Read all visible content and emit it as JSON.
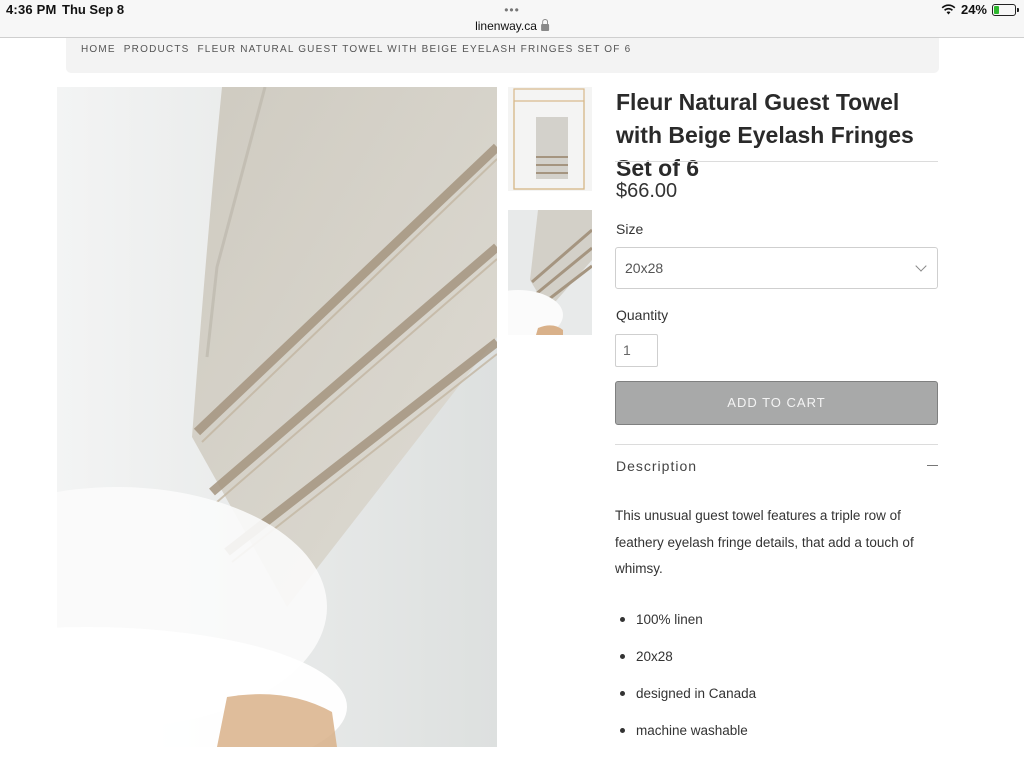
{
  "status_bar": {
    "time": "4:36 PM",
    "date": "Thu Sep 8",
    "battery": "24%",
    "battery_level": 0.24
  },
  "browser": {
    "url": "linenway.ca"
  },
  "breadcrumb": [
    "HOME",
    "PRODUCTS",
    "FLEUR NATURAL GUEST TOWEL WITH BEIGE EYELASH FRINGES SET OF 6"
  ],
  "product": {
    "title": "Fleur Natural Guest Towel with Beige Eyelash Fringes Set of 6",
    "price": "$66.00",
    "size_label": "Size",
    "size_value": "20x28",
    "quantity_label": "Quantity",
    "quantity_value": "1",
    "add_to_cart": "ADD TO CART",
    "description_heading": "Description",
    "description": "This unusual guest towel features a triple row of feathery eyelash fringe details, that add a touch of whimsy.",
    "features": [
      "100% linen",
      "20x28",
      "designed in Canada",
      "machine washable"
    ]
  },
  "colors": {
    "button": "#a8a9a9",
    "linen": "#d2cfc6",
    "fringe": "#a08f7a"
  }
}
